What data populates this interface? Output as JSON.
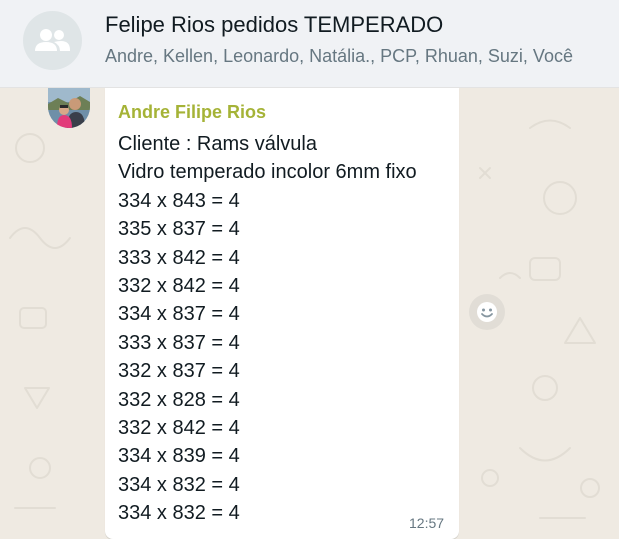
{
  "header": {
    "title": "Felipe Rios pedidos TEMPERADO",
    "members": "Andre, Kellen, Leonardo, Natália., PCP, Rhuan, Suzi, Você",
    "avatar_icon": "group-icon"
  },
  "message": {
    "sender": "Andre Filipe Rios",
    "sender_color": "#a5b337",
    "lines": [
      "Cliente : Rams válvula",
      "Vidro temperado incolor 6mm fixo",
      "334 x 843 = 4",
      "335 x 837 = 4",
      "333 x 842 = 4",
      "332 x 842 = 4",
      "334 x 837 = 4",
      "333 x 837 = 4",
      "332 x 837 = 4",
      "332 x 828 = 4",
      "332 x 842 = 4",
      "334 x 839 = 4",
      "334 x 832 = 4",
      "334 x 832 = 4"
    ],
    "time": "12:57"
  },
  "reaction_button": {
    "icon": "emoji-smile-icon"
  },
  "colors": {
    "header_bg": "#f0f2f5",
    "chat_bg": "#efeae2",
    "bubble_bg": "#ffffff",
    "text": "#111b21",
    "muted": "#667781"
  }
}
